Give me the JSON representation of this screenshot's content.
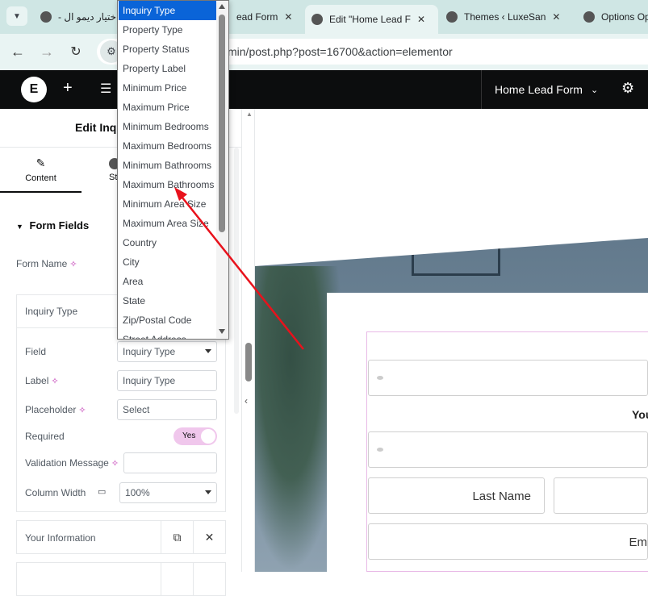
{
  "browser": {
    "tabs": [
      {
        "label": "- اختيار ديمو ال",
        "active": false
      },
      {
        "label": "ead Form",
        "active": false
      },
      {
        "label": "Edit \"Home Lead F",
        "active": true
      },
      {
        "label": "Themes ‹ LuxeSan",
        "active": false
      },
      {
        "label": "Options Op",
        "active": false
      }
    ],
    "tab_close": "✕",
    "url": "min/post.php?post=16700&action=elementor"
  },
  "editor": {
    "document_title": "Home Lead Form",
    "panel_title": "Edit Inqu",
    "tabs": [
      {
        "label": "Content"
      },
      {
        "label": "St"
      }
    ],
    "section_title": "Form Fields",
    "form_name_label": "Form Name",
    "repeater_item_title": "Inquiry Type",
    "field_label": "Field",
    "field_value": "Inquiry Type",
    "label_label": "Label",
    "label_value": "Inquiry Type",
    "placeholder_label": "Placeholder",
    "placeholder_value": "Select",
    "required_label": "Required",
    "required_toggle": "Yes",
    "validation_label": "Validation Message",
    "validation_value": "",
    "column_width_label": "Column Width",
    "column_width_value": "100%",
    "next_item_title": "Your Information"
  },
  "dropdown": {
    "selected": "Inquiry Type",
    "options": [
      "Inquiry Type",
      "Property Type",
      "Property Status",
      "Property Label",
      "Minimum Price",
      "Maximum Price",
      "Minimum Bedrooms",
      "Maximum Bedrooms",
      "Minimum Bathrooms",
      "Maximum Bathrooms",
      "Minimum Area Size",
      "Maximum Area Size",
      "Country",
      "City",
      "Area",
      "State",
      "Zip/Postal Code",
      "Street Address"
    ]
  },
  "preview": {
    "section_heading": "You",
    "last_name_placeholder": "Last Name",
    "email_placeholder": "Em"
  },
  "colors": {
    "accent_selected": "#0a64d8",
    "toggle_on": "#f0c7ec",
    "form_outline": "#e8b9e6",
    "annotation_arrow": "#e8121c"
  }
}
